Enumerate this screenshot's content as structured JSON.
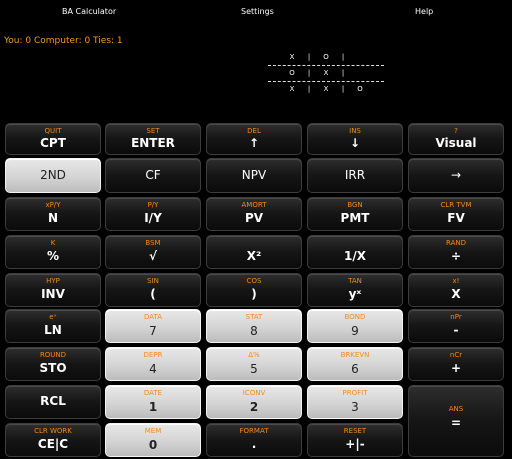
{
  "menu": {
    "item1": "BA Calculator",
    "item2": "Settings",
    "item3": "Help"
  },
  "score": "You: 0 Computer: 0 Ties: 1",
  "board": {
    "rows": [
      [
        "X",
        "O",
        ""
      ],
      [
        "O",
        "X",
        ""
      ],
      [
        "X",
        "X",
        "O"
      ]
    ]
  },
  "keys": {
    "cpt": {
      "secondary": "QUIT",
      "primary": "CPT"
    },
    "enter": {
      "secondary": "SET",
      "primary": "ENTER"
    },
    "up": {
      "secondary": "DEL",
      "primary": "↑"
    },
    "down": {
      "secondary": "INS",
      "primary": "↓"
    },
    "visual": {
      "secondary": "?",
      "primary": "Visual"
    },
    "second": {
      "primary": "2ND"
    },
    "cf": {
      "primary": "CF"
    },
    "npv": {
      "primary": "NPV"
    },
    "irr": {
      "primary": "IRR"
    },
    "arrow": {
      "primary": "→"
    },
    "n": {
      "secondary": "xP/Y",
      "primary": "N"
    },
    "iy": {
      "secondary": "P/Y",
      "primary": "I/Y"
    },
    "pv": {
      "secondary": "AMORT",
      "primary": "PV"
    },
    "pmt": {
      "secondary": "BGN",
      "primary": "PMT"
    },
    "fv": {
      "secondary": "CLR TVM",
      "primary": "FV"
    },
    "pct": {
      "secondary": "K",
      "primary": "%"
    },
    "sqrt": {
      "secondary": "BSM",
      "primary": "√"
    },
    "sq": {
      "secondary": "",
      "primary": "X²"
    },
    "inv1x": {
      "secondary": "",
      "primary": "1/X"
    },
    "div": {
      "secondary": "RAND",
      "primary": "÷"
    },
    "inv": {
      "secondary": "HYP",
      "primary": "INV"
    },
    "lparen": {
      "secondary": "SIN",
      "primary": "("
    },
    "rparen": {
      "secondary": "COS",
      "primary": ")"
    },
    "yx": {
      "secondary": "TAN",
      "primary": "yˣ"
    },
    "mul": {
      "secondary": "x!",
      "primary": "X"
    },
    "ln": {
      "secondary": "eˣ",
      "primary": "LN"
    },
    "k7": {
      "secondary": "DATA",
      "primary": "7"
    },
    "k8": {
      "secondary": "STAT",
      "primary": "8"
    },
    "k9": {
      "secondary": "BOND",
      "primary": "9"
    },
    "minus": {
      "secondary": "nPr",
      "primary": "-"
    },
    "sto": {
      "secondary": "ROUND",
      "primary": "STO"
    },
    "k4": {
      "secondary": "DEPR",
      "primary": "4"
    },
    "k5": {
      "secondary": "Δ%",
      "primary": "5"
    },
    "k6": {
      "secondary": "BRKEVN",
      "primary": "6"
    },
    "plus": {
      "secondary": "nCr",
      "primary": "+"
    },
    "rcl": {
      "primary": "RCL"
    },
    "k1": {
      "secondary": "DATE",
      "primary": "1"
    },
    "k2": {
      "secondary": "ICONV",
      "primary": "2"
    },
    "k3": {
      "secondary": "PROFIT",
      "primary": "3"
    },
    "eq": {
      "secondary": "ANS",
      "primary": "="
    },
    "cec": {
      "secondary": "CLR WORK",
      "primary": "CE|C"
    },
    "k0": {
      "secondary": "MEM",
      "primary": "0"
    },
    "dot": {
      "secondary": "FORMAT",
      "primary": "."
    },
    "pm": {
      "secondary": "RESET",
      "primary": "+|-"
    }
  }
}
